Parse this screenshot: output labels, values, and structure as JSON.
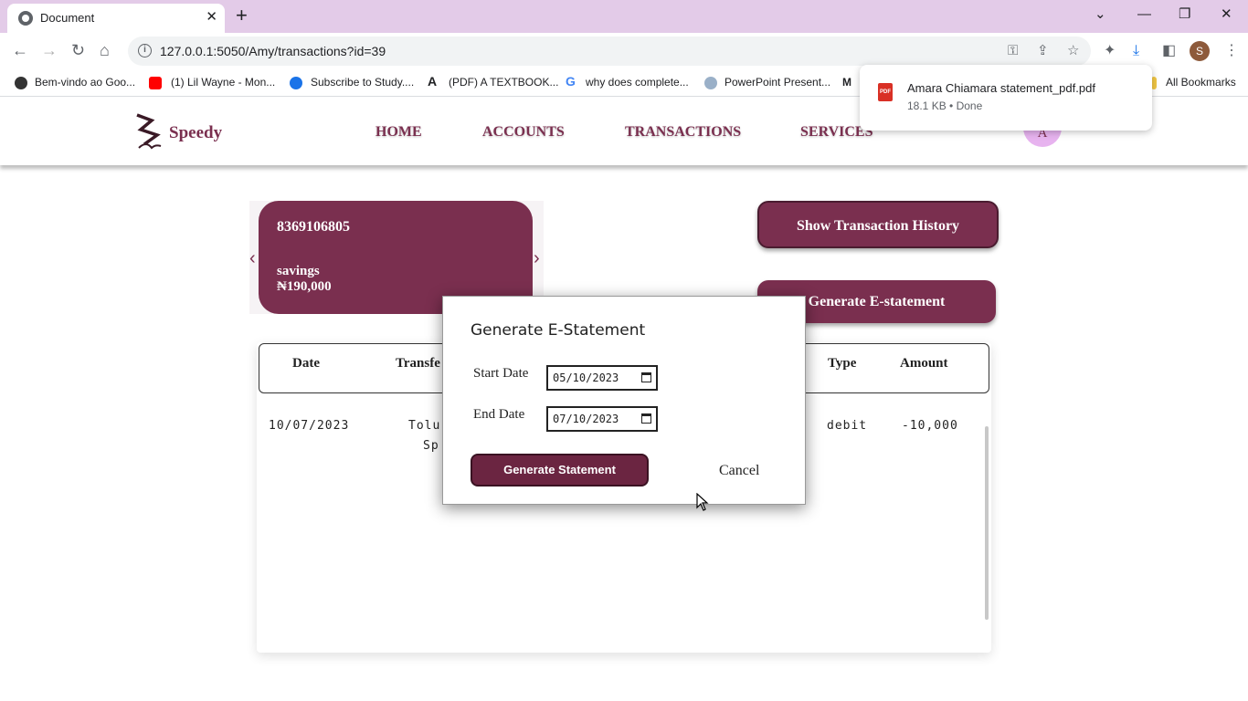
{
  "browser": {
    "tab_title": "Document",
    "url": "127.0.0.1:5050/Amy/transactions?id=39",
    "bookmarks": [
      "Bem-vindo ao Goo...",
      "(1) Lil Wayne - Mon...",
      "Subscribe to Study....",
      "(PDF) A TEXTBOOK...",
      "why does complete...",
      "PowerPoint Present..."
    ],
    "all_bookmarks": "All Bookmarks",
    "profile_initial": "S",
    "download": {
      "filename": "Amara Chiamara statement_pdf.pdf",
      "status": "18.1 KB • Done"
    }
  },
  "app": {
    "brand": "Speedy",
    "nav": [
      "HOME",
      "ACCOUNTS",
      "TRANSACTIONS",
      "SERVICES"
    ],
    "avatar_initial": "A",
    "account": {
      "number": "8369106805",
      "type": "savings",
      "balance": "₦190,000"
    },
    "buttons": {
      "history": "Show Transaction History",
      "estatement": "Generate E-statement"
    },
    "table": {
      "headers": [
        "Date",
        "Transfe",
        "Type",
        "Amount"
      ],
      "rows": [
        {
          "date": "10/07/2023",
          "desc_line1": "Tolu",
          "desc_line2": "Sp",
          "type": "debit",
          "amount": "-10,000"
        }
      ]
    }
  },
  "modal": {
    "title": "Generate E-Statement",
    "start_label": "Start Date",
    "start_value": "05/10/2023",
    "end_label": "End Date",
    "end_value": "07/10/2023",
    "generate_label": "Generate Statement",
    "cancel_label": "Cancel"
  },
  "colors": {
    "brand": "#7a2f4f",
    "tabbar": "#e3cbe8",
    "avatar": "#e7b3ef"
  }
}
